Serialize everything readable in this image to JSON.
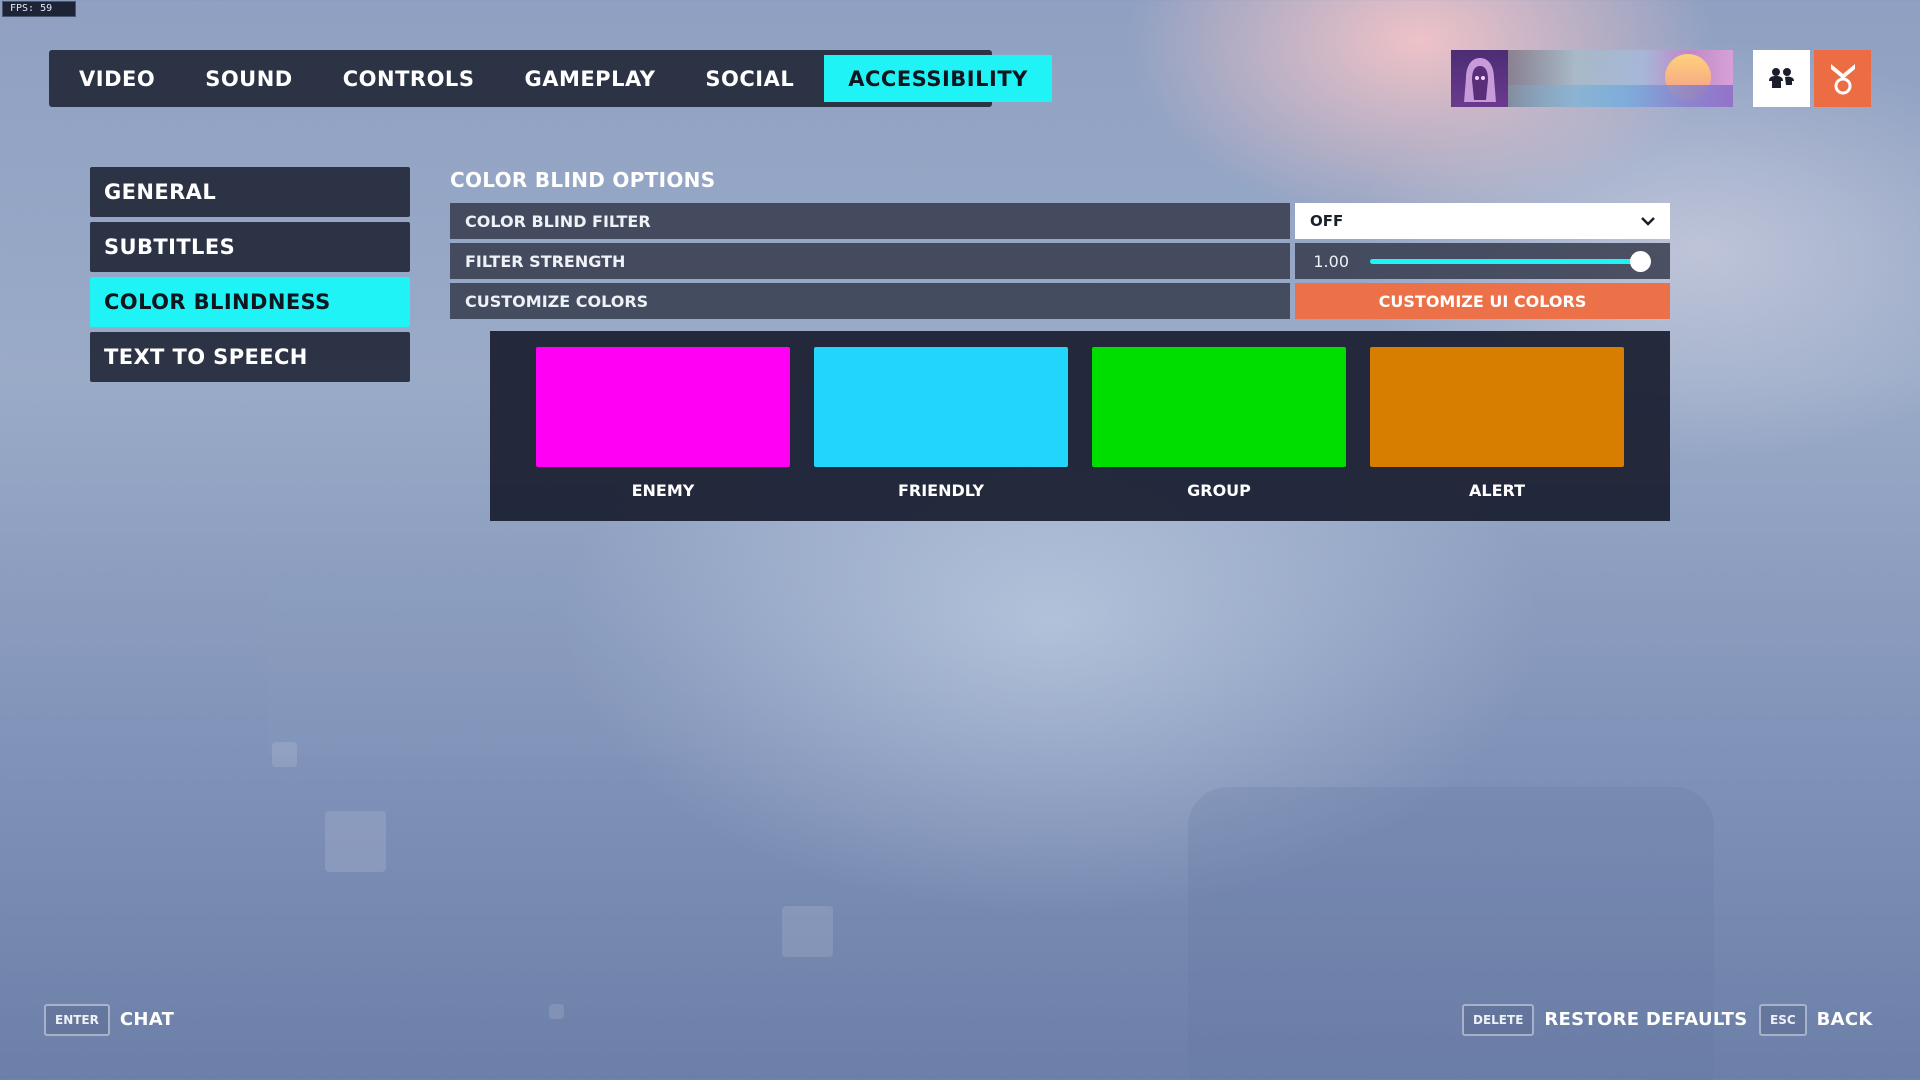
{
  "fps": "FPS: 59",
  "tabs": [
    {
      "label": "VIDEO"
    },
    {
      "label": "SOUND"
    },
    {
      "label": "CONTROLS"
    },
    {
      "label": "GAMEPLAY"
    },
    {
      "label": "SOCIAL"
    },
    {
      "label": "ACCESSIBILITY",
      "active": true
    }
  ],
  "submenu": [
    {
      "label": "GENERAL"
    },
    {
      "label": "SUBTITLES"
    },
    {
      "label": "COLOR BLINDNESS",
      "active": true
    },
    {
      "label": "TEXT TO SPEECH"
    }
  ],
  "section": {
    "title": "COLOR BLIND OPTIONS",
    "filter_label": "COLOR BLIND FILTER",
    "filter_value": "OFF",
    "strength_label": "FILTER STRENGTH",
    "strength_value": "1.00",
    "strength_fraction": 1.0,
    "customize_label": "CUSTOMIZE COLORS",
    "customize_button": "CUSTOMIZE UI COLORS"
  },
  "swatches": [
    {
      "label": "ENEMY",
      "color": "#ff00f5"
    },
    {
      "label": "FRIENDLY",
      "color": "#22d5fb"
    },
    {
      "label": "GROUP",
      "color": "#00de00"
    },
    {
      "label": "ALERT",
      "color": "#d77d00"
    }
  ],
  "footer": {
    "chat_key": "ENTER",
    "chat_label": "CHAT",
    "restore_key": "DELETE",
    "restore_label": "RESTORE DEFAULTS",
    "back_key": "ESC",
    "back_label": "BACK"
  },
  "colors": {
    "accent": "#1ff3f5",
    "button_orange": "#ec7048"
  },
  "icons": {
    "social": "social-icon",
    "rank": "rank-icon",
    "dropdown": "chevron-down-icon"
  }
}
